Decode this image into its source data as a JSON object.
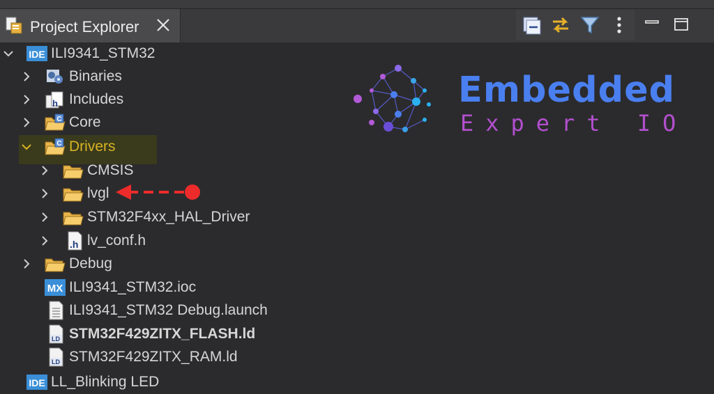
{
  "view": {
    "tab_title": "Project Explorer"
  },
  "tree": [
    {
      "label": "ILI9341_STM32",
      "icon": "ide-project-icon",
      "expanded": true
    },
    {
      "label": "Binaries",
      "icon": "binaries-icon",
      "expanded": false
    },
    {
      "label": "Includes",
      "icon": "includes-icon",
      "expanded": false
    },
    {
      "label": "Core",
      "icon": "source-folder-icon",
      "expanded": false
    },
    {
      "label": "Drivers",
      "icon": "source-folder-icon",
      "expanded": true,
      "highlighted": true
    },
    {
      "label": "CMSIS",
      "icon": "folder-icon",
      "expanded": false
    },
    {
      "label": "lvgl",
      "icon": "folder-icon",
      "expanded": false,
      "annotated": true
    },
    {
      "label": "STM32F4xx_HAL_Driver",
      "icon": "folder-icon",
      "expanded": false
    },
    {
      "label": "lv_conf.h",
      "icon": "header-file-icon",
      "expanded": false
    },
    {
      "label": "Debug",
      "icon": "folder-icon",
      "expanded": false
    },
    {
      "label": "ILI9341_STM32.ioc",
      "icon": "mx-file-icon"
    },
    {
      "label": "ILI9341_STM32 Debug.launch",
      "icon": "launch-file-icon"
    },
    {
      "label": "STM32F429ZITX_FLASH.ld",
      "icon": "linker-file-icon",
      "bold": true
    },
    {
      "label": "STM32F429ZITX_RAM.ld",
      "icon": "linker-file-icon"
    },
    {
      "label": "LL_Blinking LED",
      "icon": "ide-project-icon"
    }
  ],
  "logo": {
    "title": "Embedded",
    "subtitle": "Expert IO"
  },
  "colors": {
    "highlight_text": "#d8b423",
    "annotation_arrow": "#ee2b2b",
    "logo_blue": "#4a7ff0",
    "logo_purple": "#b34fcf"
  }
}
